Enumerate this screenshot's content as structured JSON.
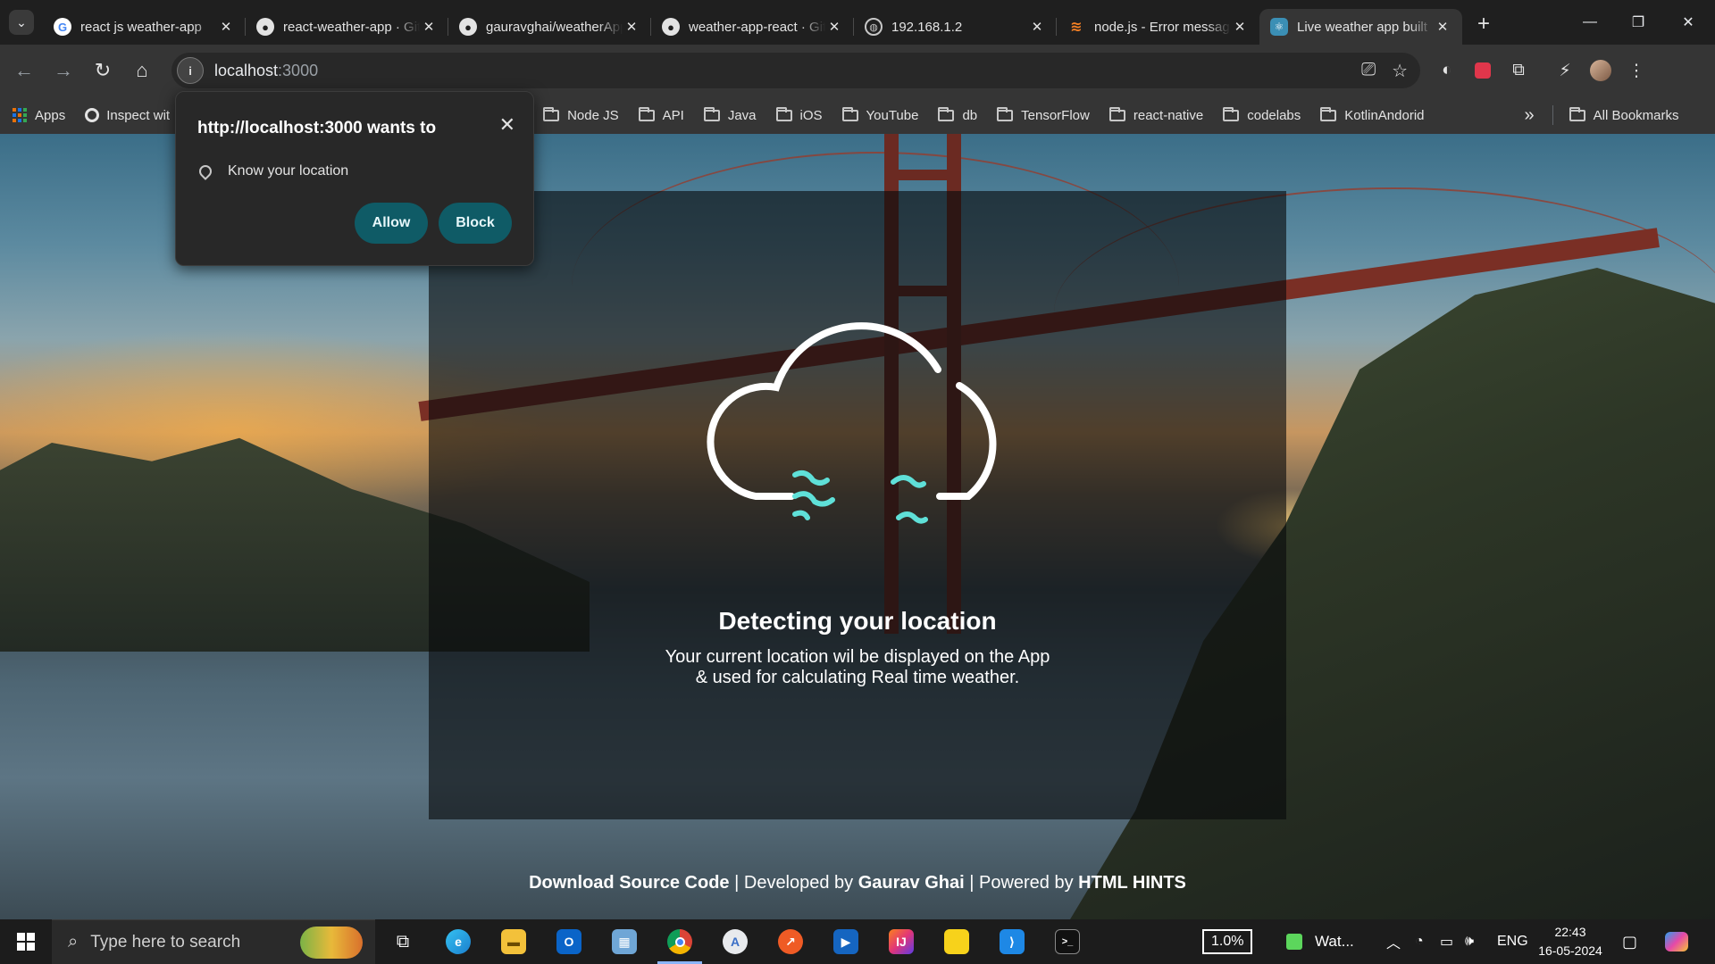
{
  "browser": {
    "tabs": [
      {
        "title": "react js weather-app",
        "favicon": "google-icon",
        "active": false
      },
      {
        "title": "react-weather-app · GitHub",
        "favicon": "github-icon",
        "active": false
      },
      {
        "title": "gauravghai/weatherApp",
        "favicon": "github-icon",
        "active": false
      },
      {
        "title": "weather-app-react · GitHub",
        "favicon": "github-icon",
        "active": false
      },
      {
        "title": "192.168.1.2",
        "favicon": "globe-icon",
        "active": false
      },
      {
        "title": "node.js - Error message",
        "favicon": "stackoverflow-icon",
        "active": false
      },
      {
        "title": "Live weather app built",
        "favicon": "react-icon",
        "active": true
      }
    ],
    "new_tab": "+",
    "window": {
      "minimize": "—",
      "restore": "❐",
      "close": "✕"
    },
    "url_host": "localhost",
    "url_port": ":3000",
    "bookmarks": [
      {
        "label": "Apps",
        "type": "apps"
      },
      {
        "label": "Inspect wit",
        "type": "site"
      },
      {
        "label": "Node JS",
        "type": "folder"
      },
      {
        "label": "API",
        "type": "folder"
      },
      {
        "label": "Java",
        "type": "folder"
      },
      {
        "label": "iOS",
        "type": "folder"
      },
      {
        "label": "YouTube",
        "type": "folder"
      },
      {
        "label": "db",
        "type": "folder"
      },
      {
        "label": "TensorFlow",
        "type": "folder"
      },
      {
        "label": "react-native",
        "type": "folder"
      },
      {
        "label": "codelabs",
        "type": "folder"
      },
      {
        "label": "KotlinAndorid",
        "type": "folder"
      }
    ],
    "bookmarks_overflow": "»",
    "all_bookmarks": "All Bookmarks"
  },
  "permission_popup": {
    "title": "http://localhost:3000 wants to",
    "request": "Know your location",
    "allow": "Allow",
    "block": "Block"
  },
  "app": {
    "heading": "Detecting your location",
    "line1": "Your current location wil be displayed on the App",
    "line2": "& used for calculating Real time weather.",
    "footer": {
      "download": "Download Source Code",
      "sep1": " | Developed by ",
      "author": "Gaurav Ghai",
      "sep2": " | Powered by ",
      "powered": "HTML HINTS"
    },
    "accent_color": "#5fe0d8"
  },
  "taskbar": {
    "search_placeholder": "Type here to search",
    "apps": [
      "task-view-icon",
      "edge-icon",
      "file-explorer-icon",
      "outlook-icon",
      "control-panel-icon",
      "chrome-icon",
      "android-studio-icon",
      "postman-icon",
      "media-player-icon",
      "intellij-icon",
      "sticky-notes-icon",
      "vscode-icon",
      "terminal-icon"
    ],
    "cpu_widget": "1.0%",
    "weather_widget": "Wat...",
    "language": "ENG",
    "time": "22:43",
    "date": "16-05-2024"
  }
}
